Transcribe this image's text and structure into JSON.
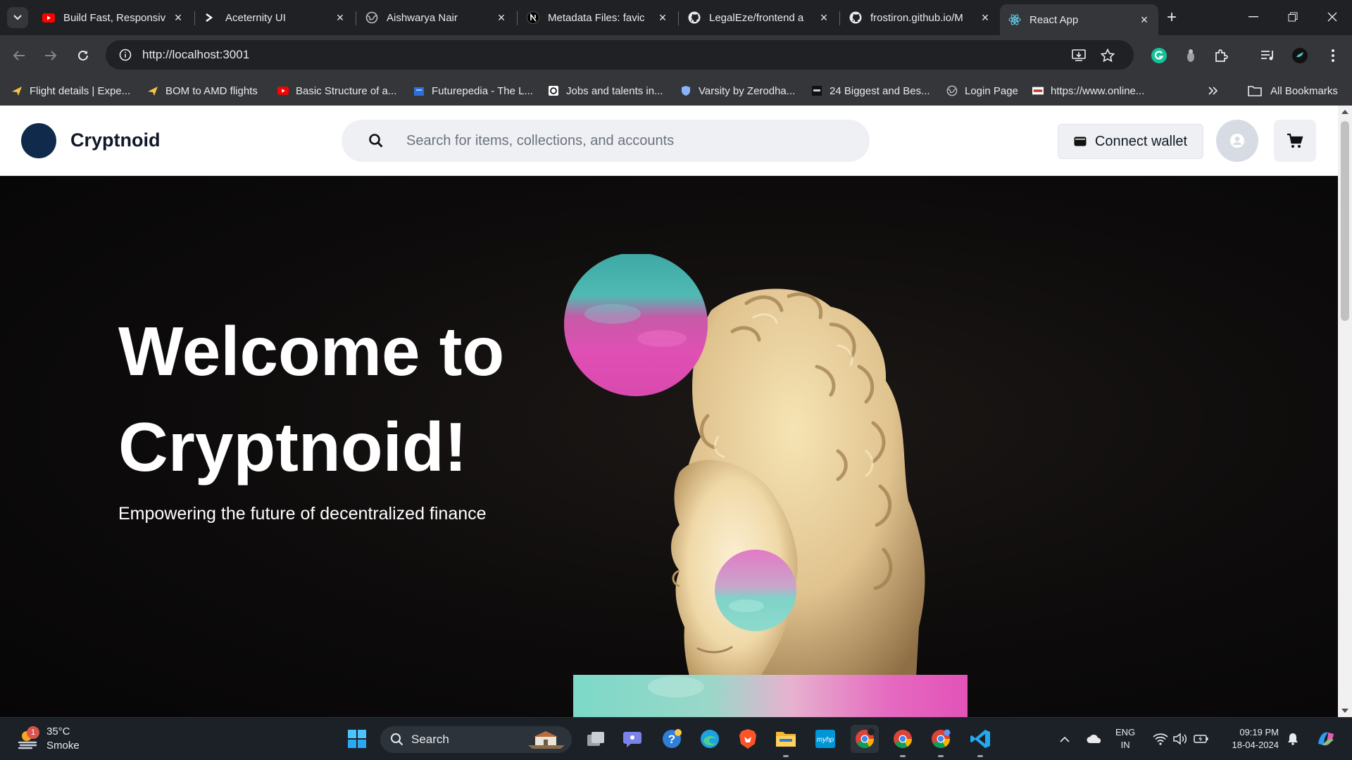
{
  "browser": {
    "tabs": [
      {
        "title": "Build Fast, Responsiv",
        "icon": "youtube-icon",
        "active": false
      },
      {
        "title": "Aceternity UI",
        "icon": "aceternity-icon",
        "active": false
      },
      {
        "title": "Aishwarya Nair",
        "icon": "globe-icon",
        "active": false
      },
      {
        "title": "Metadata Files: favic",
        "icon": "nextjs-icon",
        "active": false
      },
      {
        "title": "LegalEze/frontend a",
        "icon": "github-icon",
        "active": false
      },
      {
        "title": "frostiron.github.io/M",
        "icon": "github-icon",
        "active": false
      },
      {
        "title": "React App",
        "icon": "react-icon",
        "active": true
      }
    ],
    "url": "http://localhost:3001",
    "bookmarks": [
      {
        "label": "Flight details | Expe...",
        "icon": "plane-icon"
      },
      {
        "label": "BOM to AMD flights",
        "icon": "plane-icon"
      },
      {
        "label": "Basic Structure of a...",
        "icon": "youtube-icon"
      },
      {
        "label": "Futurepedia - The L...",
        "icon": "futurepedia-icon"
      },
      {
        "label": "Jobs and talents in...",
        "icon": "jobs-icon"
      },
      {
        "label": "Varsity by Zerodha...",
        "icon": "shield-icon"
      },
      {
        "label": "24 Biggest and Bes...",
        "icon": "site-icon"
      },
      {
        "label": "Login Page",
        "icon": "globe-icon"
      },
      {
        "label": "https://www.online...",
        "icon": "nsdl-icon"
      }
    ],
    "all_bookmarks_label": "All Bookmarks"
  },
  "site": {
    "brand": "Cryptnoid",
    "search_placeholder": "Search for items, collections, and accounts",
    "connect_wallet_label": "Connect wallet",
    "hero": {
      "title_line1": "Welcome to",
      "title_line2": "Cryptnoid!",
      "subtitle": "Empowering the future of decentralized finance"
    }
  },
  "taskbar": {
    "weather_temp": "35°C",
    "weather_desc": "Smoke",
    "weather_badge": "1",
    "search_label": "Search",
    "lang_line1": "ENG",
    "lang_line2": "IN",
    "time": "09:19 PM",
    "date": "18-04-2024"
  },
  "colors": {
    "brand_logo": "#0f2a4a",
    "teal": "#6fd3c4",
    "pink": "#e04fb4",
    "hero_bg": "#0b0a0a"
  }
}
